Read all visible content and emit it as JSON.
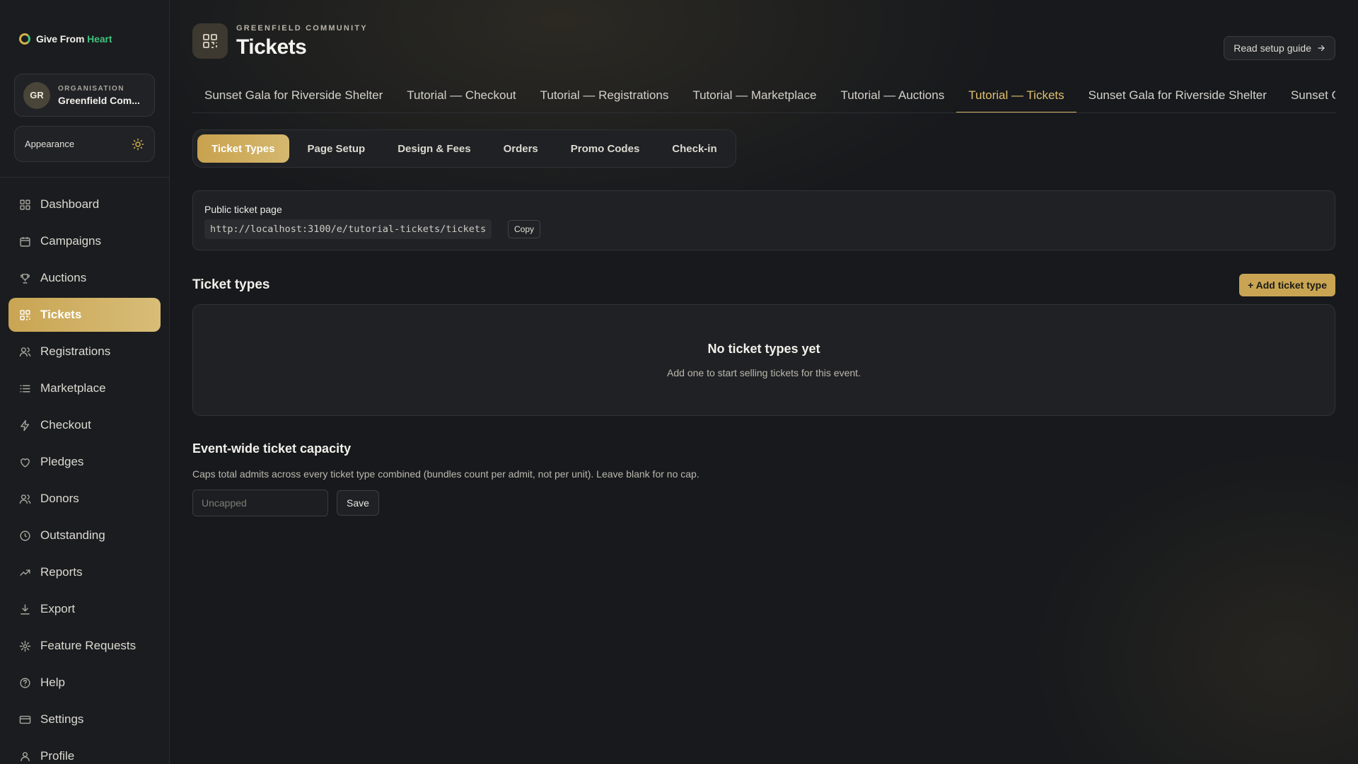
{
  "brand": {
    "prefix": "Give From",
    "accent": "Heart"
  },
  "organisation": {
    "caption": "ORGANISATION",
    "initials": "GR",
    "name": "Greenfield Com..."
  },
  "appearance": {
    "label": "Appearance"
  },
  "sidebar": {
    "items": [
      {
        "label": "Dashboard",
        "icon": "dashboard-icon"
      },
      {
        "label": "Campaigns",
        "icon": "calendar-icon"
      },
      {
        "label": "Auctions",
        "icon": "trophy-icon"
      },
      {
        "label": "Tickets",
        "icon": "qr-grid-icon",
        "active": true
      },
      {
        "label": "Registrations",
        "icon": "users-icon"
      },
      {
        "label": "Marketplace",
        "icon": "list-icon"
      },
      {
        "label": "Checkout",
        "icon": "lightning-icon"
      },
      {
        "label": "Pledges",
        "icon": "heart-icon"
      },
      {
        "label": "Donors",
        "icon": "users-icon"
      },
      {
        "label": "Outstanding",
        "icon": "clock-icon"
      },
      {
        "label": "Reports",
        "icon": "trending-up-icon"
      },
      {
        "label": "Export",
        "icon": "download-icon"
      },
      {
        "label": "Feature Requests",
        "icon": "sparkle-icon"
      },
      {
        "label": "Help",
        "icon": "help-circle-icon"
      },
      {
        "label": "Settings",
        "icon": "credit-card-icon"
      },
      {
        "label": "Profile",
        "icon": "user-icon"
      }
    ]
  },
  "header": {
    "caption": "GREENFIELD COMMUNITY",
    "title": "Tickets",
    "guide_label": "Read setup guide"
  },
  "event_tabs": [
    {
      "label": "Sunset Gala for Riverside Shelter"
    },
    {
      "label": "Tutorial — Checkout"
    },
    {
      "label": "Tutorial — Registrations"
    },
    {
      "label": "Tutorial — Marketplace"
    },
    {
      "label": "Tutorial — Auctions"
    },
    {
      "label": "Tutorial — Tickets",
      "active": true
    },
    {
      "label": "Sunset Gala for Riverside Shelter"
    },
    {
      "label": "Sunset Gala for Riverside Shelter"
    }
  ],
  "section_tabs": [
    {
      "label": "Ticket Types",
      "active": true
    },
    {
      "label": "Page Setup"
    },
    {
      "label": "Design & Fees"
    },
    {
      "label": "Orders"
    },
    {
      "label": "Promo Codes"
    },
    {
      "label": "Check-in"
    }
  ],
  "public_page": {
    "label": "Public ticket page",
    "url": "http://localhost:3100/e/tutorial-tickets/tickets",
    "copy_label": "Copy"
  },
  "ticket_types": {
    "title": "Ticket types",
    "add_label": "+ Add ticket type",
    "empty_title": "No ticket types yet",
    "empty_desc": "Add one to start selling tickets for this event."
  },
  "capacity": {
    "title": "Event-wide ticket capacity",
    "desc": "Caps total admits across every ticket type combined (bundles count per admit, not per unit). Leave blank for no cap.",
    "placeholder": "Uncapped",
    "value": "",
    "save_label": "Save"
  },
  "colors": {
    "accent": "#c9a553",
    "brand_green": "#3fc27d",
    "active_tab": "#e0bf6e"
  }
}
